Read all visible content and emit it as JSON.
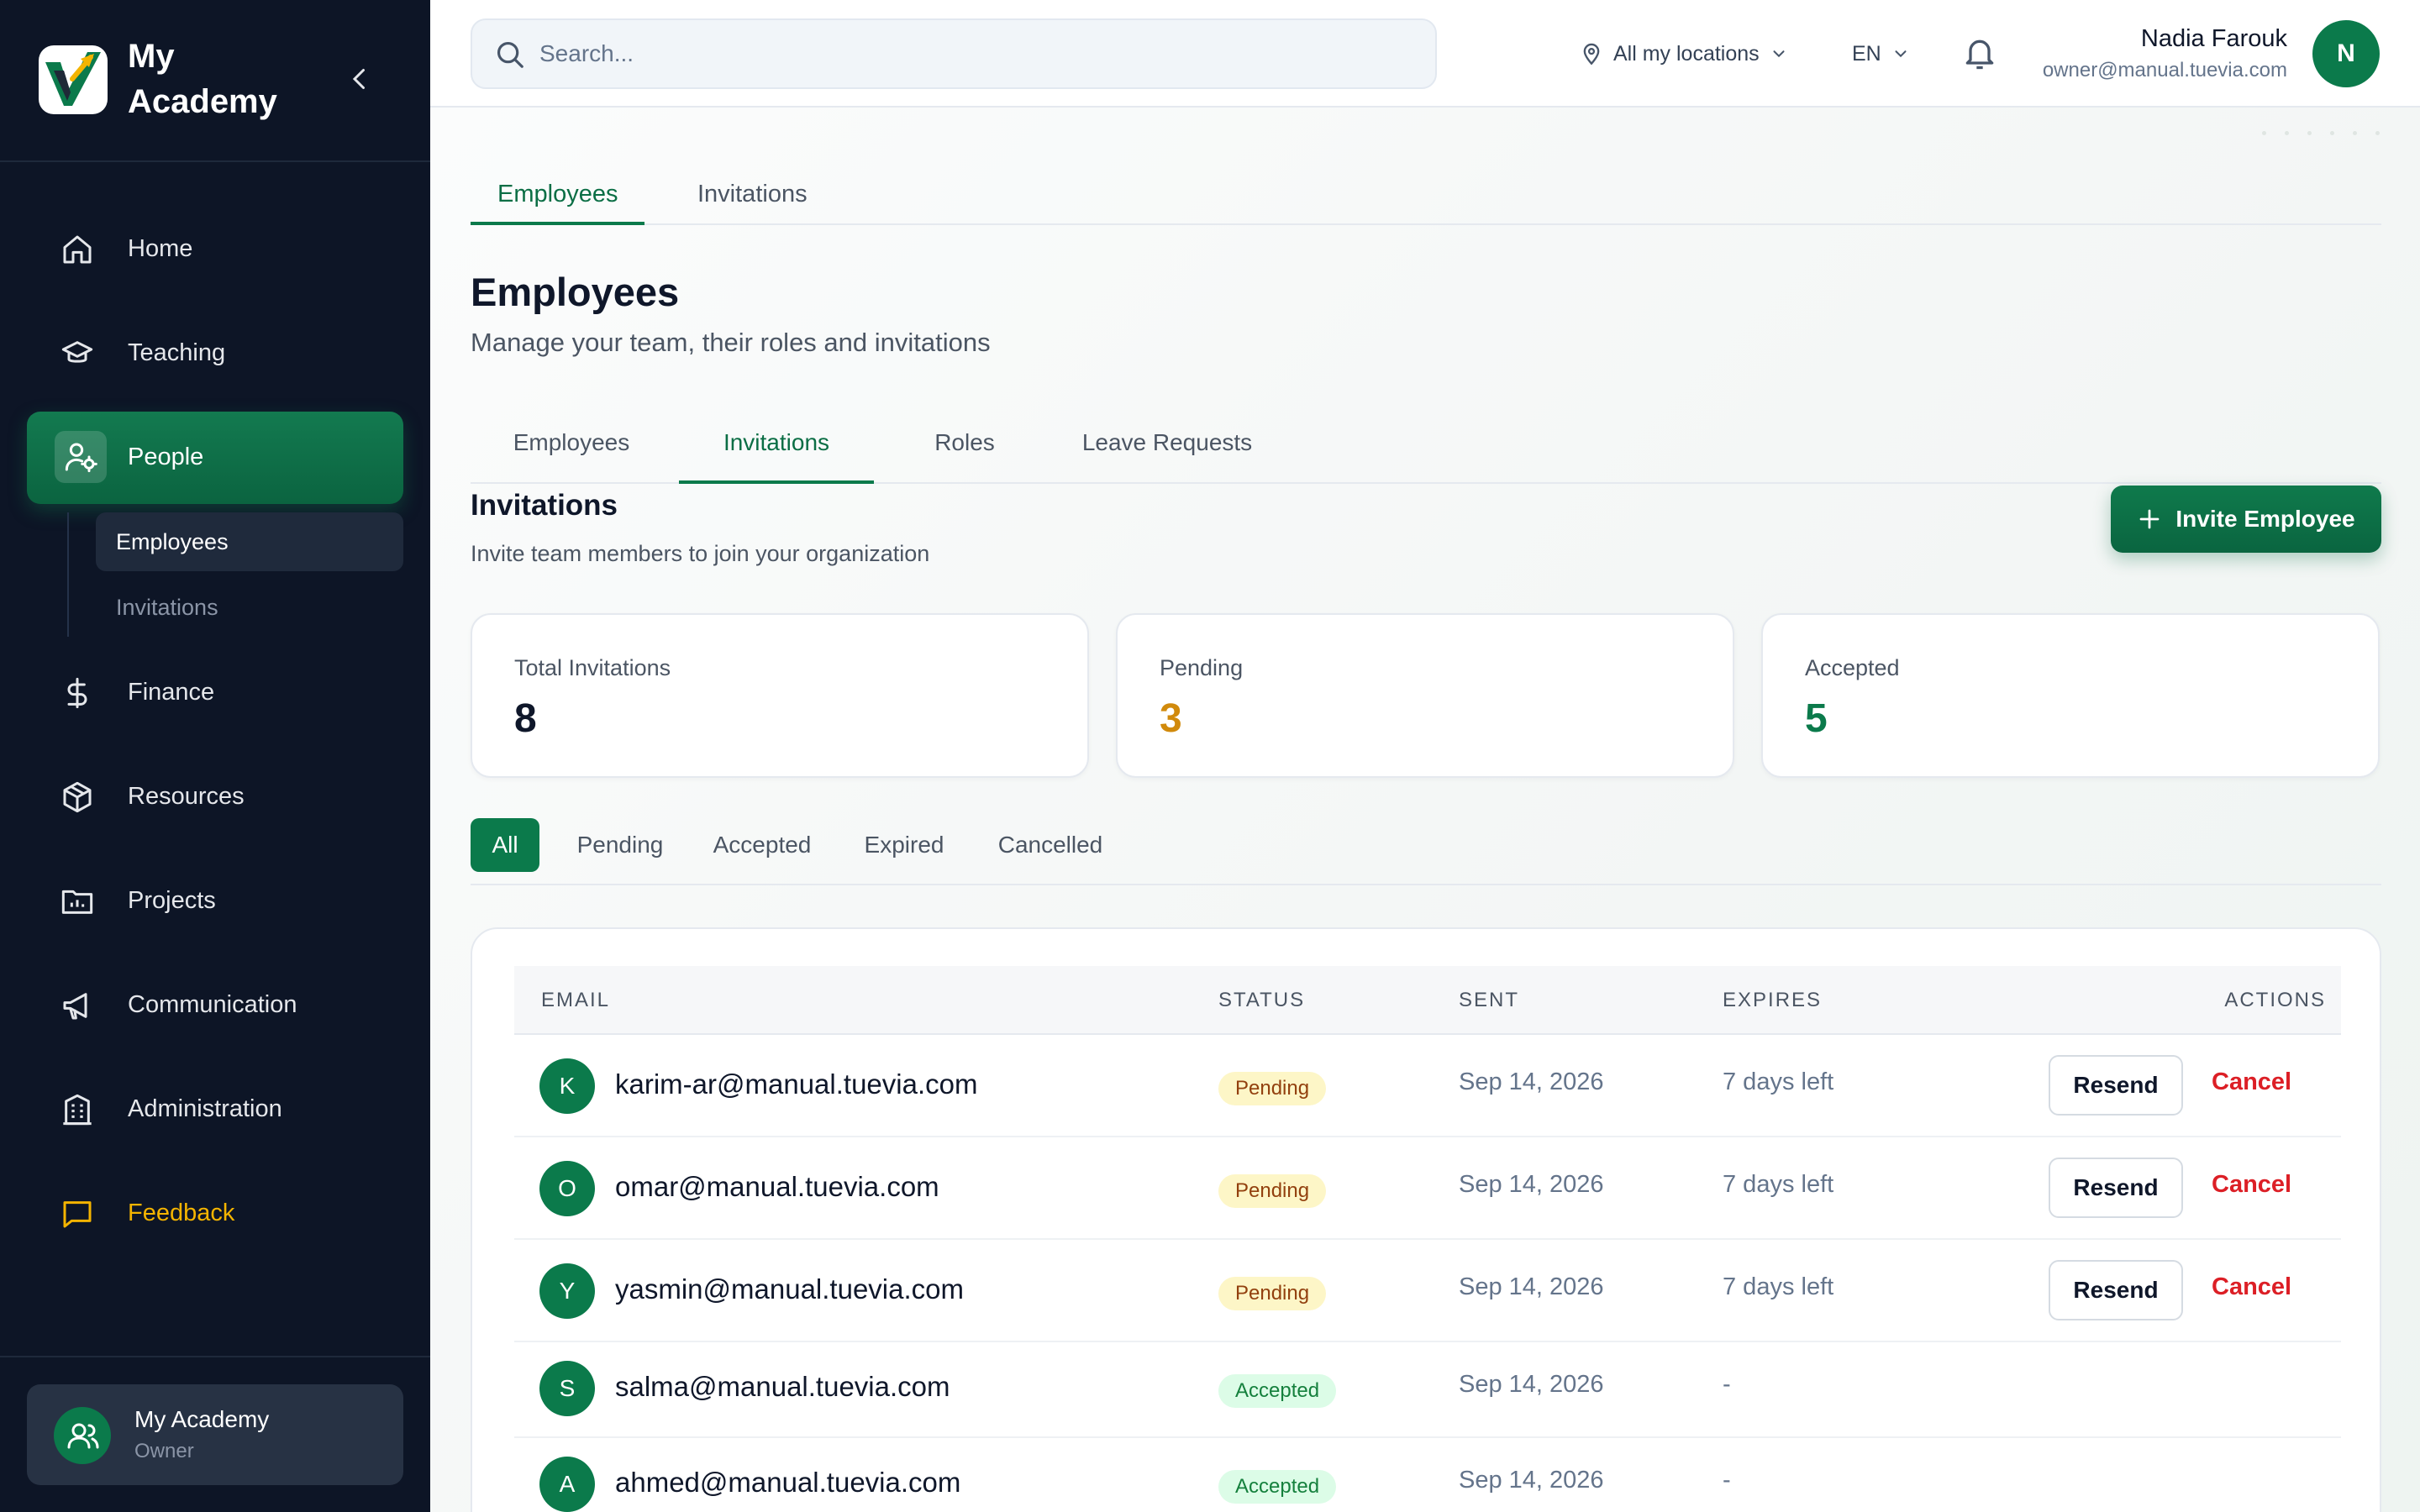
{
  "app": {
    "name": "My Academy"
  },
  "sidebar": {
    "items": [
      {
        "label": "Home",
        "icon": "home-icon"
      },
      {
        "label": "Teaching",
        "icon": "graduation-cap-icon"
      },
      {
        "label": "People",
        "icon": "user-cog-icon"
      },
      {
        "label": "Finance",
        "icon": "dollar-icon"
      },
      {
        "label": "Resources",
        "icon": "box-icon"
      },
      {
        "label": "Projects",
        "icon": "folder-chart-icon"
      },
      {
        "label": "Communication",
        "icon": "megaphone-icon"
      },
      {
        "label": "Administration",
        "icon": "building-icon"
      },
      {
        "label": "Feedback",
        "icon": "message-square-icon"
      }
    ],
    "active": "People",
    "sub_items": [
      {
        "label": "Employees",
        "active": true
      },
      {
        "label": "Invitations",
        "active": false
      }
    ],
    "account": {
      "name": "My Academy",
      "role": "Owner"
    }
  },
  "topbar": {
    "search_placeholder": "Search...",
    "location": "All my locations",
    "language": "EN",
    "user": {
      "name": "Nadia Farouk",
      "email": "owner@manual.tuevia.com",
      "initial": "N"
    }
  },
  "page": {
    "top_tabs": [
      "Employees",
      "Invitations"
    ],
    "title": "Employees",
    "subtitle": "Manage your team, their roles and invitations",
    "section_tabs": [
      "Employees",
      "Invitations",
      "Roles",
      "Leave Requests"
    ],
    "active_section_tab": "Invitations",
    "section_title": "Invitations",
    "section_subtitle": "Invite team members to join your organization",
    "invite_button": "Invite Employee"
  },
  "stats": [
    {
      "label": "Total Invitations",
      "value": "8",
      "color": "#0f172a"
    },
    {
      "label": "Pending",
      "value": "3",
      "color": "#d18a0c"
    },
    {
      "label": "Accepted",
      "value": "5",
      "color": "#0b7a4b"
    }
  ],
  "filters": [
    "All",
    "Pending",
    "Accepted",
    "Expired",
    "Cancelled"
  ],
  "table": {
    "columns": [
      "EMAIL",
      "STATUS",
      "SENT",
      "EXPIRES",
      "ACTIONS"
    ],
    "rows": [
      {
        "initial": "K",
        "email": "karim-ar@manual.tuevia.com",
        "status": "Pending",
        "sent": "Sep 14, 2026",
        "expires": "7 days left"
      },
      {
        "initial": "O",
        "email": "omar@manual.tuevia.com",
        "status": "Pending",
        "sent": "Sep 14, 2026",
        "expires": "7 days left"
      },
      {
        "initial": "Y",
        "email": "yasmin@manual.tuevia.com",
        "status": "Pending",
        "sent": "Sep 14, 2026",
        "expires": "7 days left"
      },
      {
        "initial": "S",
        "email": "salma@manual.tuevia.com",
        "status": "Accepted",
        "sent": "Sep 14, 2026",
        "expires": "-"
      },
      {
        "initial": "A",
        "email": "ahmed@manual.tuevia.com",
        "status": "Accepted",
        "sent": "Sep 14, 2026",
        "expires": "-"
      }
    ],
    "resend_label": "Resend",
    "cancel_label": "Cancel"
  }
}
